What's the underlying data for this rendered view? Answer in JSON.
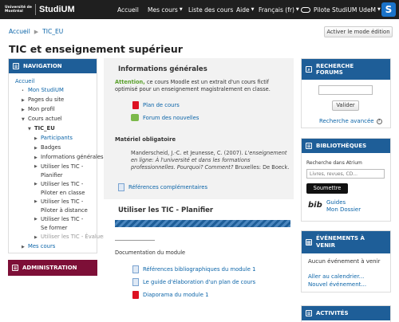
{
  "topbar": {
    "logo_mark": "Université de Montréal",
    "logo_text": "StudiUM",
    "nav": [
      "Accueil",
      "Mes cours",
      "Liste des cours",
      "Aide",
      "Français (fr)"
    ],
    "user": "Pilote StudiUM UdeM",
    "s_button": "S"
  },
  "breadcrumb": [
    "Accueil",
    "TIC_EU"
  ],
  "edit_button": "Activer le mode édition",
  "page_title": "TIC et enseignement supérieur",
  "navigation": {
    "title": "NAVIGATION",
    "items": [
      {
        "label": "Accueil"
      },
      {
        "label": "Mon StudiUM"
      },
      {
        "label": "Pages du site"
      },
      {
        "label": "Mon profil"
      },
      {
        "label": "Cours actuel"
      },
      {
        "label": "TIC_EU"
      },
      {
        "label": "Participants"
      },
      {
        "label": "Badges"
      },
      {
        "label": "Informations générales"
      },
      {
        "label": "Utiliser les TIC - Planifier"
      },
      {
        "label": "Utiliser les TIC - Piloter en classe"
      },
      {
        "label": "Utiliser les TIC - Piloter à distance"
      },
      {
        "label": "Utiliser les TIC - Se former"
      },
      {
        "label": "Utiliser les TIC - Évaluer"
      },
      {
        "label": "Mes cours"
      }
    ]
  },
  "administration": {
    "title": "ADMINISTRATION"
  },
  "main": {
    "info_title": "Informations générales",
    "attention": "Attention,",
    "attention_text": " ce cours Moodle est un extrait d'un cours fictif optimisé pour un enseignement magistralement en classe.",
    "res1": "Plan de cours",
    "res2": "Forum des nouvelles",
    "materiel_title": "Matériel obligatoire",
    "ref_text_1": "Manderscheid, J.-C. et Jeunesse, C. (2007). ",
    "ref_text_2": "L'enseignement en ligne: À l'université et dans les formations professionnelles. Pourquoi? Comment?",
    "ref_text_3": " Bruxelles: De Boeck.",
    "ref_comp": "Références complémentaires",
    "planifier_title": "Utiliser les TIC - Planifier",
    "doc_title": "Documentation du module",
    "doc1": "Références bibliographiques du module 1",
    "doc2": "Le guide d'élaboration d'un plan de cours",
    "doc3": "Diaporama du module 1"
  },
  "recherche": {
    "title": "RECHERCHE FORUMS",
    "button": "Valider",
    "advanced": "Recherche avancée"
  },
  "bibliotheques": {
    "title": "BIBLIOTHÈQUES",
    "label": "Recherche dans Atrium",
    "placeholder": "Livres, revues, CD...",
    "button": "Soumettre",
    "links": [
      "Guides",
      "Mon Dossier"
    ],
    "logo": "bib"
  },
  "evenements": {
    "title": "ÉVÉNEMENTS À VENIR",
    "none": "Aucun événement à venir",
    "links": [
      "Aller au calendrier...",
      "Nouvel événement..."
    ]
  },
  "activites": {
    "title": "ACTIVITÉS"
  }
}
